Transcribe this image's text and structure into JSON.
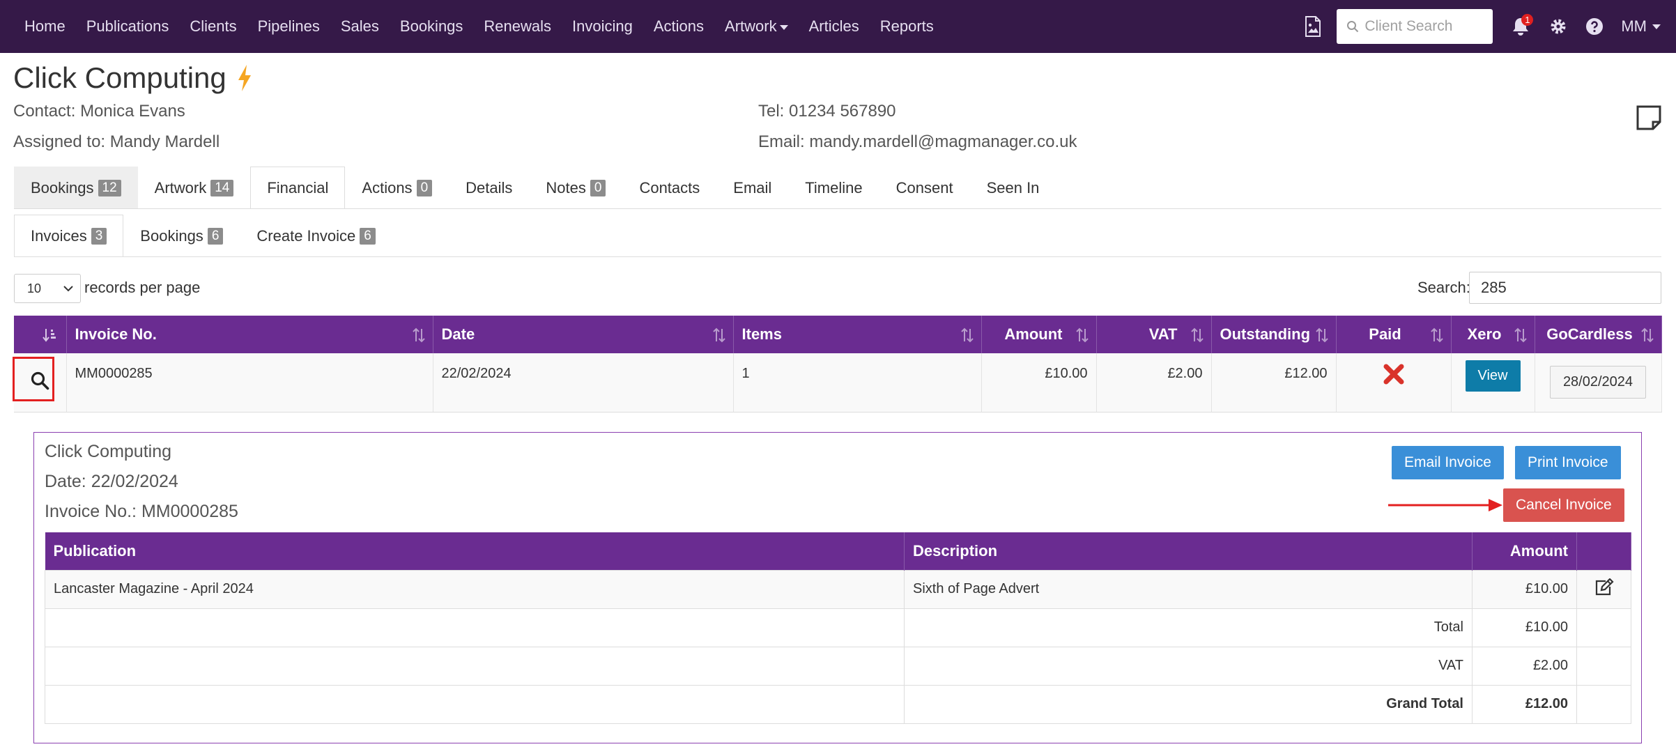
{
  "nav": {
    "items": [
      "Home",
      "Publications",
      "Clients",
      "Pipelines",
      "Sales",
      "Bookings",
      "Renewals",
      "Invoicing",
      "Actions",
      "Artwork",
      "Articles",
      "Reports"
    ],
    "search_placeholder": "Client Search",
    "notification_count": "1",
    "user_initials": "MM"
  },
  "client": {
    "name": "Click Computing",
    "contact_label": "Contact:",
    "contact_name": "Monica Evans",
    "assigned_label": "Assigned to:",
    "assigned_name": "Mandy Mardell",
    "tel_label": "Tel:",
    "tel": "01234 567890",
    "email_label": "Email:",
    "email": "mandy.mardell@magmanager.co.uk"
  },
  "tabs": [
    {
      "label": "Bookings",
      "badge": "12"
    },
    {
      "label": "Artwork",
      "badge": "14"
    },
    {
      "label": "Financial",
      "badge": ""
    },
    {
      "label": "Actions",
      "badge": "0"
    },
    {
      "label": "Details",
      "badge": ""
    },
    {
      "label": "Notes",
      "badge": "0"
    },
    {
      "label": "Contacts",
      "badge": ""
    },
    {
      "label": "Email",
      "badge": ""
    },
    {
      "label": "Timeline",
      "badge": ""
    },
    {
      "label": "Consent",
      "badge": ""
    },
    {
      "label": "Seen In",
      "badge": ""
    }
  ],
  "subtabs": [
    {
      "label": "Invoices",
      "badge": "3"
    },
    {
      "label": "Bookings",
      "badge": "6"
    },
    {
      "label": "Create Invoice",
      "badge": "6"
    }
  ],
  "controls": {
    "records_value": "10",
    "records_label": "records per page",
    "search_label": "Search:",
    "search_value": "285"
  },
  "table": {
    "headers": [
      "Invoice No.",
      "Date",
      "Items",
      "Amount",
      "VAT",
      "Outstanding",
      "Paid",
      "Xero",
      "GoCardless"
    ],
    "row": {
      "invoice_no": "MM0000285",
      "date": "22/02/2024",
      "items": "1",
      "amount": "£10.00",
      "vat": "£2.00",
      "outstanding": "£12.00",
      "xero_label": "View",
      "gocardless_date": "28/02/2024"
    }
  },
  "detail": {
    "client_name": "Click Computing",
    "date_line": "Date: 22/02/2024",
    "invoice_line": "Invoice No.: MM0000285",
    "email_btn": "Email Invoice",
    "print_btn": "Print Invoice",
    "cancel_btn": "Cancel Invoice",
    "headers": {
      "publication": "Publication",
      "description": "Description",
      "amount": "Amount"
    },
    "line_item": {
      "publication": "Lancaster Magazine - April 2024",
      "description": "Sixth of Page Advert",
      "amount": "£10.00"
    },
    "totals": [
      {
        "label": "Total",
        "value": "£10.00"
      },
      {
        "label": "VAT",
        "value": "£2.00"
      },
      {
        "label": "Grand Total",
        "value": "£12.00"
      }
    ]
  },
  "colors": {
    "navbar": "#351948",
    "header_purple": "#6a2c91",
    "view_btn": "#0e7ca8",
    "action_blue": "#3a8fd8",
    "cancel_red": "#d9534f",
    "paid_x": "#d9332b",
    "bolt": "#f5a623"
  }
}
